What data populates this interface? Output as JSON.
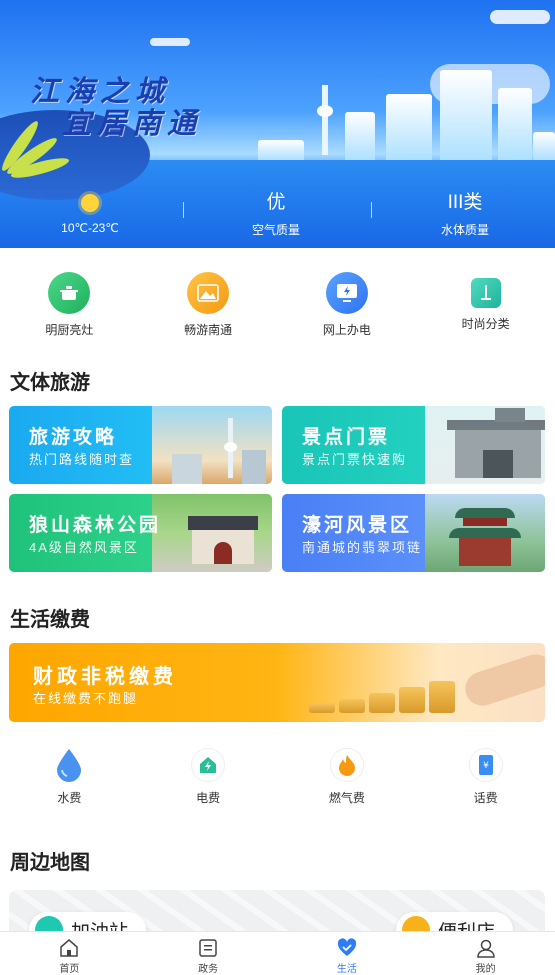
{
  "hero": {
    "slogan_line1": "江海之城",
    "slogan_line2": "宜居南通",
    "weather": [
      {
        "icon": "sun-icon",
        "value": "",
        "label": "10℃-23℃"
      },
      {
        "icon": "",
        "value": "优",
        "label": "空气质量"
      },
      {
        "icon": "",
        "value": "III类",
        "label": "水体质量"
      }
    ]
  },
  "quick": [
    {
      "label": "明厨亮灶",
      "icon": "pot-icon",
      "color": "#2fc16a"
    },
    {
      "label": "畅游南通",
      "icon": "mountain-icon",
      "color": "#f7a41c"
    },
    {
      "label": "网上办电",
      "icon": "monitor-bolt-icon",
      "color": "#2f7df6"
    },
    {
      "label": "时尚分类",
      "icon": "trash-sort-icon",
      "color": "#2fc1a0"
    }
  ],
  "sections": {
    "tourism": "文体旅游",
    "payment": "生活缴费",
    "map": "周边地图"
  },
  "cards": [
    {
      "title": "旅游攻略",
      "subtitle": "热门路线随时查"
    },
    {
      "title": "景点门票",
      "subtitle": "景点门票快速购"
    },
    {
      "title": "狼山森林公园",
      "subtitle": "4A级自然风景区"
    },
    {
      "title": "濠河风景区",
      "subtitle": "南通城的翡翠项链"
    }
  ],
  "banner": {
    "title": "财政非税缴费",
    "subtitle": "在线缴费不跑腿"
  },
  "payments": [
    {
      "label": "水费",
      "icon": "water-drop-icon"
    },
    {
      "label": "电费",
      "icon": "electric-house-icon"
    },
    {
      "label": "燃气费",
      "icon": "flame-icon"
    },
    {
      "label": "话费",
      "icon": "phone-bill-icon"
    }
  ],
  "map": {
    "left_pill": "加油站",
    "right_pill": "便利店"
  },
  "tabs": [
    {
      "label": "首页",
      "icon": "home-icon",
      "active": false
    },
    {
      "label": "政务",
      "icon": "document-icon",
      "active": false
    },
    {
      "label": "生活",
      "icon": "heart-icon",
      "active": true
    },
    {
      "label": "我的",
      "icon": "user-icon",
      "active": false
    }
  ],
  "colors": {
    "primary": "#2f7df6",
    "active_tab": "#2f7df6"
  }
}
